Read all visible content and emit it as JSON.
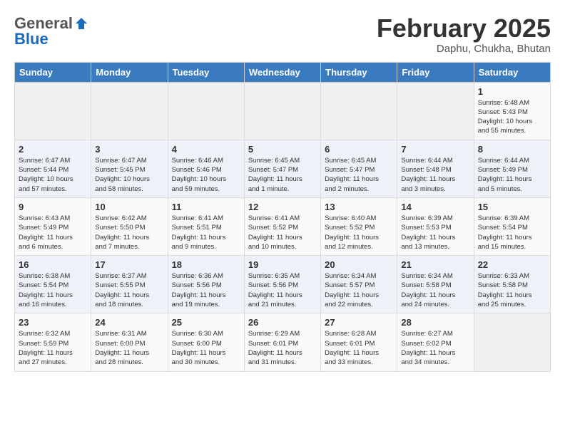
{
  "header": {
    "logo_general": "General",
    "logo_blue": "Blue",
    "month": "February 2025",
    "location": "Daphu, Chukha, Bhutan"
  },
  "weekdays": [
    "Sunday",
    "Monday",
    "Tuesday",
    "Wednesday",
    "Thursday",
    "Friday",
    "Saturday"
  ],
  "weeks": [
    [
      {
        "day": "",
        "info": ""
      },
      {
        "day": "",
        "info": ""
      },
      {
        "day": "",
        "info": ""
      },
      {
        "day": "",
        "info": ""
      },
      {
        "day": "",
        "info": ""
      },
      {
        "day": "",
        "info": ""
      },
      {
        "day": "1",
        "info": "Sunrise: 6:48 AM\nSunset: 5:43 PM\nDaylight: 10 hours\nand 55 minutes."
      }
    ],
    [
      {
        "day": "2",
        "info": "Sunrise: 6:47 AM\nSunset: 5:44 PM\nDaylight: 10 hours\nand 57 minutes."
      },
      {
        "day": "3",
        "info": "Sunrise: 6:47 AM\nSunset: 5:45 PM\nDaylight: 10 hours\nand 58 minutes."
      },
      {
        "day": "4",
        "info": "Sunrise: 6:46 AM\nSunset: 5:46 PM\nDaylight: 10 hours\nand 59 minutes."
      },
      {
        "day": "5",
        "info": "Sunrise: 6:45 AM\nSunset: 5:47 PM\nDaylight: 11 hours\nand 1 minute."
      },
      {
        "day": "6",
        "info": "Sunrise: 6:45 AM\nSunset: 5:47 PM\nDaylight: 11 hours\nand 2 minutes."
      },
      {
        "day": "7",
        "info": "Sunrise: 6:44 AM\nSunset: 5:48 PM\nDaylight: 11 hours\nand 3 minutes."
      },
      {
        "day": "8",
        "info": "Sunrise: 6:44 AM\nSunset: 5:49 PM\nDaylight: 11 hours\nand 5 minutes."
      }
    ],
    [
      {
        "day": "9",
        "info": "Sunrise: 6:43 AM\nSunset: 5:49 PM\nDaylight: 11 hours\nand 6 minutes."
      },
      {
        "day": "10",
        "info": "Sunrise: 6:42 AM\nSunset: 5:50 PM\nDaylight: 11 hours\nand 7 minutes."
      },
      {
        "day": "11",
        "info": "Sunrise: 6:41 AM\nSunset: 5:51 PM\nDaylight: 11 hours\nand 9 minutes."
      },
      {
        "day": "12",
        "info": "Sunrise: 6:41 AM\nSunset: 5:52 PM\nDaylight: 11 hours\nand 10 minutes."
      },
      {
        "day": "13",
        "info": "Sunrise: 6:40 AM\nSunset: 5:52 PM\nDaylight: 11 hours\nand 12 minutes."
      },
      {
        "day": "14",
        "info": "Sunrise: 6:39 AM\nSunset: 5:53 PM\nDaylight: 11 hours\nand 13 minutes."
      },
      {
        "day": "15",
        "info": "Sunrise: 6:39 AM\nSunset: 5:54 PM\nDaylight: 11 hours\nand 15 minutes."
      }
    ],
    [
      {
        "day": "16",
        "info": "Sunrise: 6:38 AM\nSunset: 5:54 PM\nDaylight: 11 hours\nand 16 minutes."
      },
      {
        "day": "17",
        "info": "Sunrise: 6:37 AM\nSunset: 5:55 PM\nDaylight: 11 hours\nand 18 minutes."
      },
      {
        "day": "18",
        "info": "Sunrise: 6:36 AM\nSunset: 5:56 PM\nDaylight: 11 hours\nand 19 minutes."
      },
      {
        "day": "19",
        "info": "Sunrise: 6:35 AM\nSunset: 5:56 PM\nDaylight: 11 hours\nand 21 minutes."
      },
      {
        "day": "20",
        "info": "Sunrise: 6:34 AM\nSunset: 5:57 PM\nDaylight: 11 hours\nand 22 minutes."
      },
      {
        "day": "21",
        "info": "Sunrise: 6:34 AM\nSunset: 5:58 PM\nDaylight: 11 hours\nand 24 minutes."
      },
      {
        "day": "22",
        "info": "Sunrise: 6:33 AM\nSunset: 5:58 PM\nDaylight: 11 hours\nand 25 minutes."
      }
    ],
    [
      {
        "day": "23",
        "info": "Sunrise: 6:32 AM\nSunset: 5:59 PM\nDaylight: 11 hours\nand 27 minutes."
      },
      {
        "day": "24",
        "info": "Sunrise: 6:31 AM\nSunset: 6:00 PM\nDaylight: 11 hours\nand 28 minutes."
      },
      {
        "day": "25",
        "info": "Sunrise: 6:30 AM\nSunset: 6:00 PM\nDaylight: 11 hours\nand 30 minutes."
      },
      {
        "day": "26",
        "info": "Sunrise: 6:29 AM\nSunset: 6:01 PM\nDaylight: 11 hours\nand 31 minutes."
      },
      {
        "day": "27",
        "info": "Sunrise: 6:28 AM\nSunset: 6:01 PM\nDaylight: 11 hours\nand 33 minutes."
      },
      {
        "day": "28",
        "info": "Sunrise: 6:27 AM\nSunset: 6:02 PM\nDaylight: 11 hours\nand 34 minutes."
      },
      {
        "day": "",
        "info": ""
      }
    ]
  ]
}
